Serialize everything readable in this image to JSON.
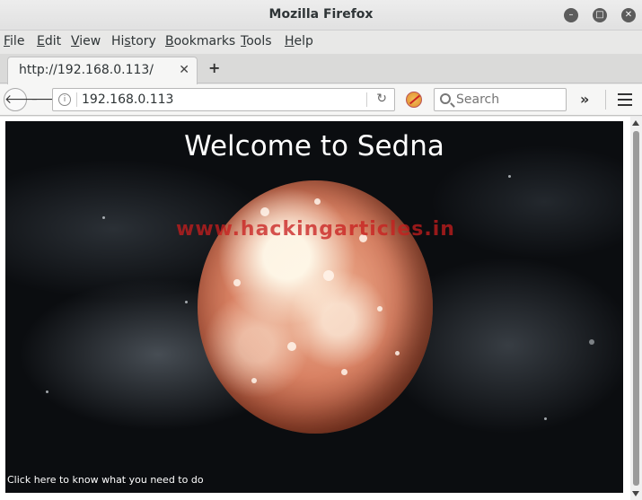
{
  "window": {
    "title": "Mozilla Firefox"
  },
  "menubar": {
    "items": [
      {
        "label": "File",
        "accel": "F",
        "rest": "ile"
      },
      {
        "label": "Edit",
        "accel": "E",
        "rest": "dit"
      },
      {
        "label": "View",
        "accel": "V",
        "rest": "iew"
      },
      {
        "label": "History",
        "accel": "s",
        "pre": "Hi",
        "rest": "tory"
      },
      {
        "label": "Bookmarks",
        "accel": "B",
        "rest": "ookmarks"
      },
      {
        "label": "Tools",
        "accel": "T",
        "rest": "ools"
      },
      {
        "label": "Help",
        "accel": "H",
        "rest": "elp"
      }
    ]
  },
  "tabs": [
    {
      "label": "http://192.168.0.113/",
      "close": "✕"
    }
  ],
  "newtab_label": "+",
  "navbar": {
    "url": "192.168.0.113",
    "search_placeholder": "Search",
    "overflow": "»"
  },
  "page": {
    "heading": "Welcome to Sedna",
    "watermark": "www.hackingarticles.in",
    "link": "Click here to know what you need to do"
  },
  "colors": {
    "page_background": "#0b0d10",
    "planet": "#d98264",
    "watermark": "#c81e1e"
  }
}
